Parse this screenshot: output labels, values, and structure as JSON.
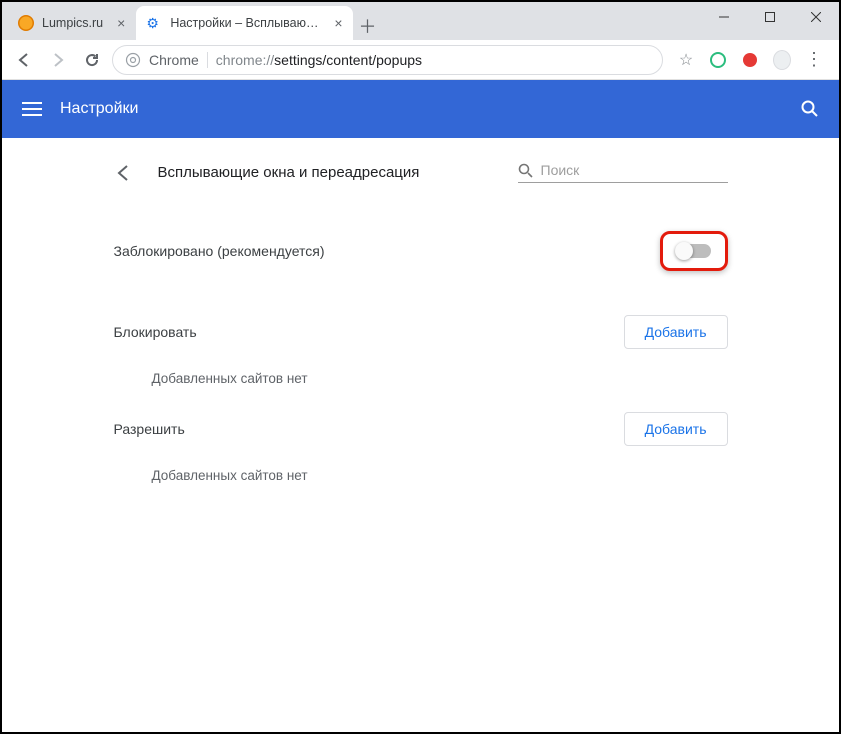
{
  "window": {
    "tabs": [
      {
        "title": "Lumpics.ru",
        "active": false
      },
      {
        "title": "Настройки – Всплывающие окн",
        "active": true
      }
    ]
  },
  "omnibox": {
    "chip": "Chrome",
    "url_prefix": "chrome://",
    "url_main": "settings/content/popups"
  },
  "blueHeader": {
    "title": "Настройки"
  },
  "page": {
    "title": "Всплывающие окна и переадресация",
    "searchPlaceholder": "Поиск",
    "blockedLabel": "Заблокировано (рекомендуется)",
    "toggleOn": false,
    "sections": {
      "block": {
        "title": "Блокировать",
        "addLabel": "Добавить",
        "empty": "Добавленных сайтов нет"
      },
      "allow": {
        "title": "Разрешить",
        "addLabel": "Добавить",
        "empty": "Добавленных сайтов нет"
      }
    }
  }
}
